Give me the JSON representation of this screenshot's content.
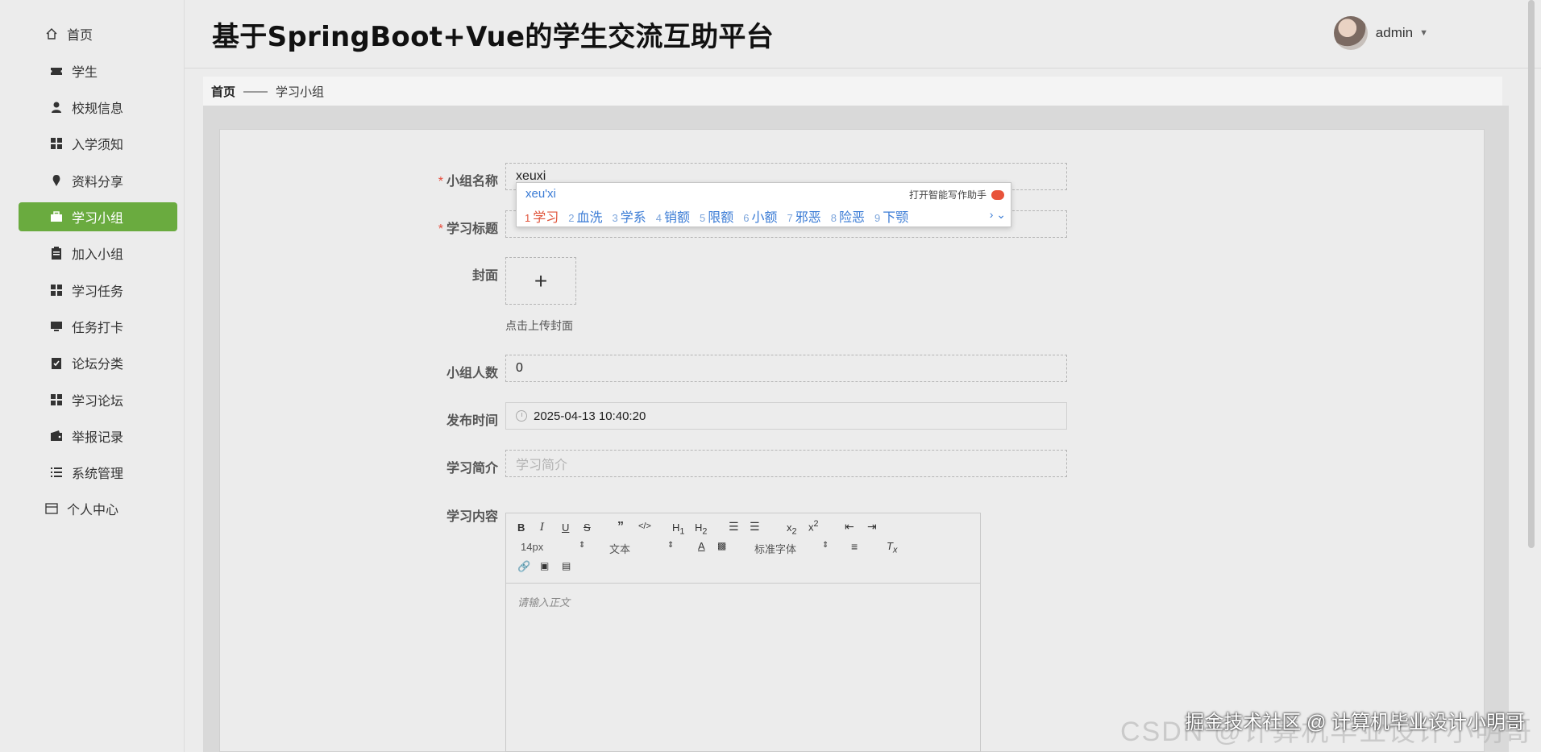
{
  "header": {
    "title": "基于SpringBoot+Vue的学生交流互助平台",
    "user_name": "admin"
  },
  "sidebar": {
    "items": [
      {
        "label": "首页",
        "icon": "home-icon"
      },
      {
        "label": "学生",
        "icon": "ticket-icon"
      },
      {
        "label": "校规信息",
        "icon": "user-icon"
      },
      {
        "label": "入学须知",
        "icon": "grid-icon"
      },
      {
        "label": "资料分享",
        "icon": "pin-icon"
      },
      {
        "label": "学习小组",
        "icon": "briefcase-icon"
      },
      {
        "label": "加入小组",
        "icon": "clipboard-icon"
      },
      {
        "label": "学习任务",
        "icon": "grid-icon"
      },
      {
        "label": "任务打卡",
        "icon": "monitor-icon"
      },
      {
        "label": "论坛分类",
        "icon": "checklist-icon"
      },
      {
        "label": "学习论坛",
        "icon": "grid-icon"
      },
      {
        "label": "举报记录",
        "icon": "wallet-icon"
      },
      {
        "label": "系统管理",
        "icon": "list-icon"
      },
      {
        "label": "个人中心",
        "icon": "card-icon"
      }
    ],
    "active": "学习小组",
    "accent": "#6aab3f"
  },
  "breadcrumb": {
    "home": "首页",
    "separator": "——",
    "current": "学习小组"
  },
  "form": {
    "group_name_label": "小组名称",
    "group_name_value": "xeuxi",
    "study_title_label": "学习标题",
    "cover_label": "封面",
    "cover_tip": "点击上传封面",
    "members_label": "小组人数",
    "members_value": "0",
    "publish_time_label": "发布时间",
    "publish_time_value": "2025-04-13 10:40:20",
    "intro_label": "学习简介",
    "intro_placeholder": "学习简介",
    "content_label": "学习内容",
    "required_mark": "*"
  },
  "ime": {
    "composing": "xeu'xi",
    "assistant": "打开智能写作助手",
    "candidates": [
      {
        "n": "1",
        "text": "学习"
      },
      {
        "n": "2",
        "text": "血洗"
      },
      {
        "n": "3",
        "text": "学系"
      },
      {
        "n": "4",
        "text": "销额"
      },
      {
        "n": "5",
        "text": "限额"
      },
      {
        "n": "6",
        "text": "小额"
      },
      {
        "n": "7",
        "text": "邪恶"
      },
      {
        "n": "8",
        "text": "险恶"
      },
      {
        "n": "9",
        "text": "下颚"
      }
    ]
  },
  "editor": {
    "font_size": "14px",
    "text_type": "文本",
    "font_family": "标准字体",
    "placeholder": "请输入正文"
  },
  "watermark": {
    "line1": "掘金技术社区 @ 计算机毕业设计小明哥",
    "line2": "CSDN @计算机毕业设计小明哥"
  }
}
